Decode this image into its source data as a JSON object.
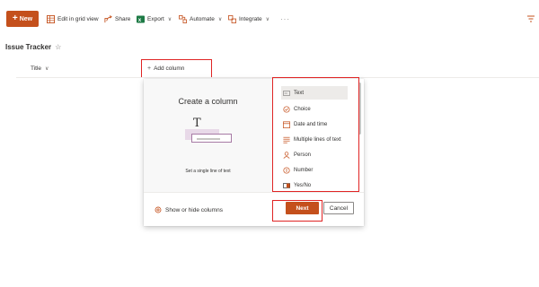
{
  "toolbar": {
    "new_label": "New",
    "edit_grid_label": "Edit in grid view",
    "share_label": "Share",
    "export_label": "Export",
    "automate_label": "Automate",
    "integrate_label": "Integrate",
    "more_label": "···"
  },
  "list": {
    "title": "Issue Tracker",
    "favorite_icon": "☆"
  },
  "columns": {
    "title_label": "Title",
    "add_column_label": "Add column"
  },
  "dialog": {
    "heading": "Create a column",
    "description": "Set a single line of text",
    "illustration_letter": "T",
    "types": [
      {
        "label": "Text",
        "icon": "text-icon",
        "selected": true
      },
      {
        "label": "Choice",
        "icon": "choice-icon"
      },
      {
        "label": "Date and time",
        "icon": "calendar-icon"
      },
      {
        "label": "Multiple lines of text",
        "icon": "multiline-icon"
      },
      {
        "label": "Person",
        "icon": "person-icon"
      },
      {
        "label": "Number",
        "icon": "number-icon"
      },
      {
        "label": "Yes/No",
        "icon": "yesno-icon"
      }
    ],
    "show_hide_label": "Show or hide columns",
    "next_label": "Next",
    "cancel_label": "Cancel"
  },
  "colors": {
    "accent": "#c4501c",
    "highlight_box": "#e02424"
  }
}
